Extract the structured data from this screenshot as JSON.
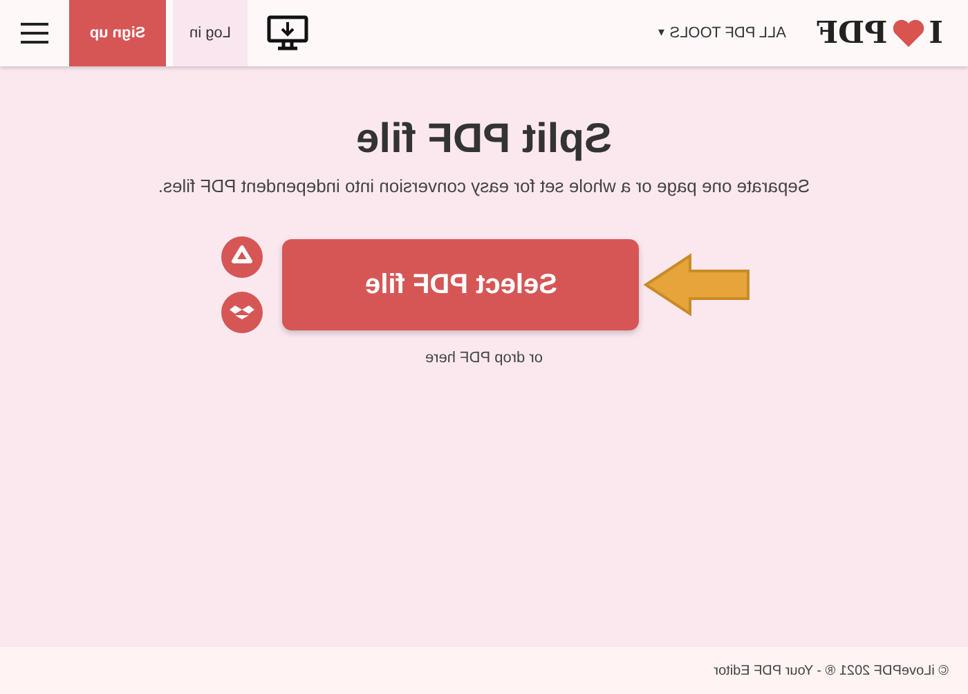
{
  "header": {
    "logo": {
      "before": "I",
      "after": "PDF"
    },
    "tools_menu": {
      "label": "ALL PDF TOOLS",
      "caret": "▾"
    },
    "login": "Log in",
    "signup": "Sign up"
  },
  "main": {
    "title": "Split PDF file",
    "subtitle": "Separate one page or a whole set for easy conversion into independent PDF files.",
    "button": "Select PDF file",
    "drop_hint": "or drop PDF here"
  },
  "footer": {
    "text": "© iLovePDF 2021 ® - Your PDF Editor"
  }
}
